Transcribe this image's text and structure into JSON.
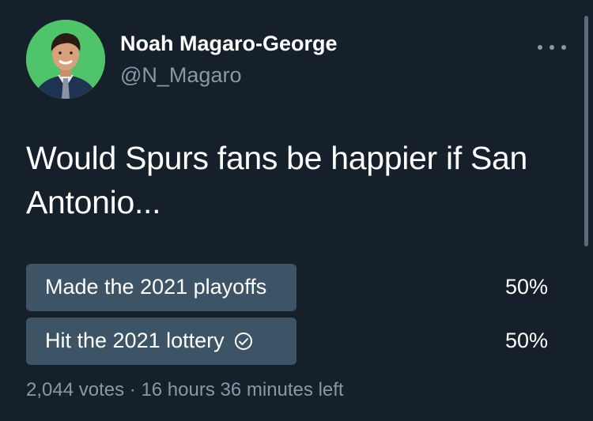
{
  "author": {
    "display_name": "Noah Magaro-George",
    "handle": "@N_Magaro",
    "avatar_bg": "#4fc46b"
  },
  "more_icon": "more-horizontal-icon",
  "tweet": {
    "text": "Would Spurs fans be happier if San Antonio..."
  },
  "poll": {
    "options": [
      {
        "label": "Made the 2021 playoffs",
        "percent_label": "50%",
        "fraction": 0.5,
        "selected": false
      },
      {
        "label": "Hit the 2021 lottery",
        "percent_label": "50%",
        "fraction": 0.5,
        "selected": true
      }
    ],
    "votes": "2,044 votes",
    "separator": "·",
    "time_left": "16 hours 36 minutes left",
    "bar_color": "#3d5466"
  },
  "colors": {
    "background": "#15202b",
    "text_primary": "#ffffff",
    "text_secondary": "#8899a6"
  }
}
